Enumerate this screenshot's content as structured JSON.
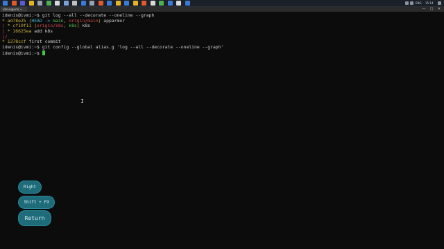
{
  "taskbar": {
    "icons": [
      {
        "name": "start-icon",
        "color": "#3a7bd5"
      },
      {
        "name": "app-icon-1",
        "color": "#e05a2b"
      },
      {
        "name": "app-icon-2",
        "color": "#5b5bd6"
      },
      {
        "name": "app-icon-3",
        "color": "#e6b422"
      },
      {
        "name": "app-icon-4",
        "color": "#9aa3ad"
      },
      {
        "name": "app-icon-5",
        "color": "#4caf50"
      },
      {
        "name": "app-icon-6",
        "color": "#d9d9d9"
      },
      {
        "name": "app-icon-7",
        "color": "#7aa2d6"
      },
      {
        "name": "app-icon-8",
        "color": "#c0c0c0"
      },
      {
        "name": "app-icon-9",
        "color": "#3a7bd5"
      },
      {
        "name": "app-icon-10",
        "color": "#9aa3ad"
      },
      {
        "name": "app-icon-11",
        "color": "#e05a2b"
      },
      {
        "name": "app-icon-12",
        "color": "#3a7bd5"
      },
      {
        "name": "app-icon-13",
        "color": "#e6b422"
      },
      {
        "name": "app-icon-14",
        "color": "#3a7bd5"
      },
      {
        "name": "app-icon-15",
        "color": "#e6b422"
      },
      {
        "name": "app-icon-16",
        "color": "#e05a2b"
      },
      {
        "name": "app-icon-17",
        "color": "#d9d9d9"
      },
      {
        "name": "app-icon-18",
        "color": "#4caf50"
      },
      {
        "name": "app-icon-19",
        "color": "#3a7bd5"
      },
      {
        "name": "app-icon-20",
        "color": "#d9d9d9"
      },
      {
        "name": "app-icon-21",
        "color": "#3a7bd5"
      }
    ],
    "tray_lang": "ENG",
    "tray_time": "15:14",
    "accent": "#1b2029"
  },
  "window": {
    "tab_title": "idenis@vmi:~",
    "minimize": "—",
    "maximize": "□",
    "close": "✕"
  },
  "terminal": {
    "lines": [
      [
        {
          "t": "idenis@ivmi:~$ git log --all --decorate --oneline --graph",
          "c": "c-prompt"
        }
      ],
      [
        {
          "t": "* ",
          "c": "c-star"
        },
        {
          "t": "ad78e25 ",
          "c": "c-hash"
        },
        {
          "t": "(",
          "c": "c-hash"
        },
        {
          "t": "HEAD -> ",
          "c": "c-head"
        },
        {
          "t": "main",
          "c": "c-branch"
        },
        {
          "t": ", ",
          "c": "c-hash"
        },
        {
          "t": "origin/main",
          "c": "c-remote"
        },
        {
          "t": ")",
          "c": "c-hash"
        },
        {
          "t": " apparmor",
          "c": "c-text"
        }
      ],
      [
        {
          "t": "| ",
          "c": "c-graph"
        },
        {
          "t": "* ",
          "c": "c-star"
        },
        {
          "t": "cf10f11 ",
          "c": "c-hash"
        },
        {
          "t": "(",
          "c": "c-hash"
        },
        {
          "t": "origin/k8s",
          "c": "c-remote"
        },
        {
          "t": ", ",
          "c": "c-hash"
        },
        {
          "t": "k8s",
          "c": "c-branch"
        },
        {
          "t": ")",
          "c": "c-hash"
        },
        {
          "t": " k8s",
          "c": "c-text"
        }
      ],
      [
        {
          "t": "| ",
          "c": "c-graph"
        },
        {
          "t": "* ",
          "c": "c-star"
        },
        {
          "t": "16625ea ",
          "c": "c-hash"
        },
        {
          "t": "add k8s",
          "c": "c-text"
        }
      ],
      [
        {
          "t": "|/",
          "c": "c-graph"
        }
      ],
      [
        {
          "t": "* ",
          "c": "c-star"
        },
        {
          "t": "1378ccf ",
          "c": "c-hash"
        },
        {
          "t": "first commit",
          "c": "c-text"
        }
      ],
      [
        {
          "t": "idenis@ivmi:~$ git config --global alias.g 'log --all --decorate --oneline --graph'",
          "c": "c-prompt"
        }
      ],
      [
        {
          "t": "idenis@ivmi:~$ ",
          "c": "c-prompt"
        }
      ]
    ],
    "cursor_color": "#3ec93e",
    "mouse_pointer": "I"
  },
  "keys": {
    "right": "Right",
    "shift_f9": "Shift + F9",
    "return": "Return"
  }
}
